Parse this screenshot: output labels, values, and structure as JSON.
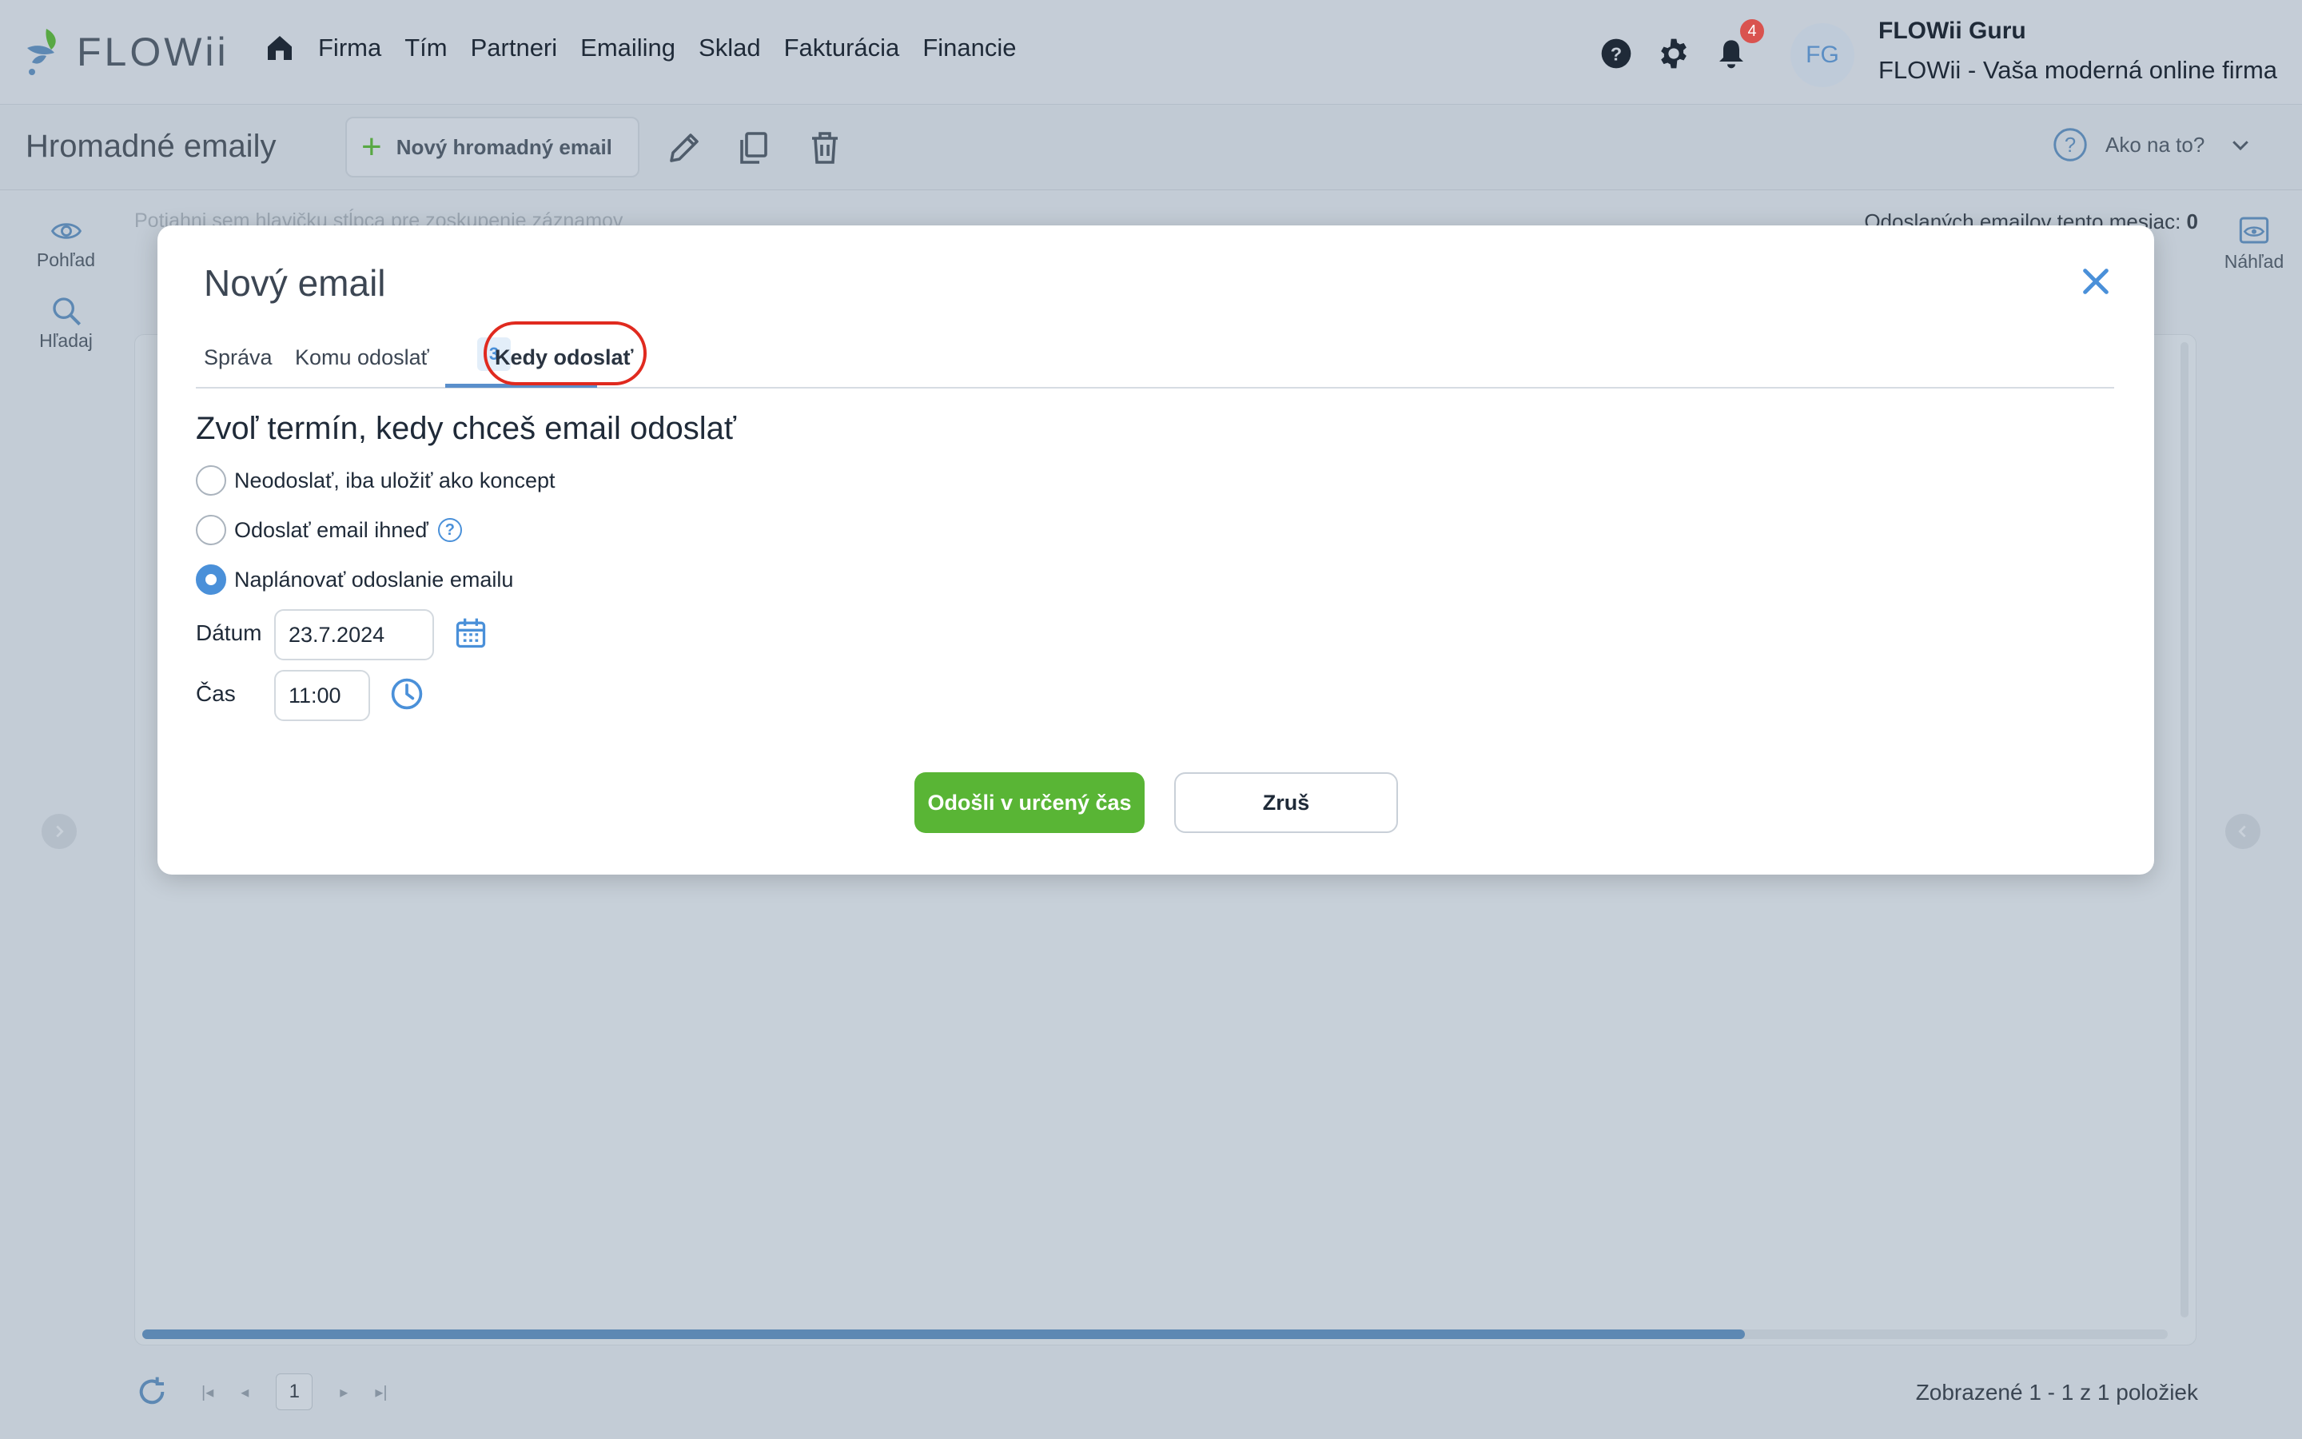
{
  "app": {
    "logo_text": "FLOWii",
    "nav": [
      "Firma",
      "Tím",
      "Partneri",
      "Emailing",
      "Sklad",
      "Fakturácia",
      "Financie"
    ],
    "notifications_count": "4",
    "avatar_initials": "FG",
    "user_name": "FLOWii Guru",
    "user_company": "FLOWii - Vaša moderná online firma"
  },
  "toolbar": {
    "page_title": "Hromadné emaily",
    "new_label": "Nový hromadný email",
    "help_label": "Ako na to?"
  },
  "sidebar_left": [
    {
      "label": "Pohľad",
      "icon": "eye-icon"
    },
    {
      "label": "Hľadaj",
      "icon": "search-icon"
    }
  ],
  "sidebar_right": {
    "label": "Náhľad",
    "icon": "preview-icon"
  },
  "grid": {
    "group_hint": "Potiahni sem hlavičku stĺpca pre zoskupenie záznamov",
    "sent_label": "Odoslaných emailov tento mesiac:",
    "sent_value": "0",
    "page_number": "1",
    "shown_text": "Zobrazené 1 - 1 z 1 položiek"
  },
  "modal": {
    "title": "Nový email",
    "tabs": [
      {
        "label": "Správa"
      },
      {
        "label": "Komu odoslať",
        "count": "3"
      },
      {
        "label": "Kedy odoslať",
        "active": true
      }
    ],
    "section_title": "Zvoľ termín, kedy chceš email odoslať",
    "options": [
      {
        "label": "Neodoslať, iba uložiť ako koncept",
        "checked": false
      },
      {
        "label": "Odoslať email ihneď",
        "checked": false,
        "help": true
      },
      {
        "label": "Naplánovať odoslanie emailu",
        "checked": true
      }
    ],
    "date_label": "Dátum",
    "date_value": "23.7.2024",
    "time_label": "Čas",
    "time_value": "11:00",
    "submit_label": "Odošli v určený čas",
    "cancel_label": "Zruš"
  },
  "colors": {
    "accent": "#4a90d9",
    "primary_button": "#59b535",
    "highlight": "#e02a1f"
  }
}
